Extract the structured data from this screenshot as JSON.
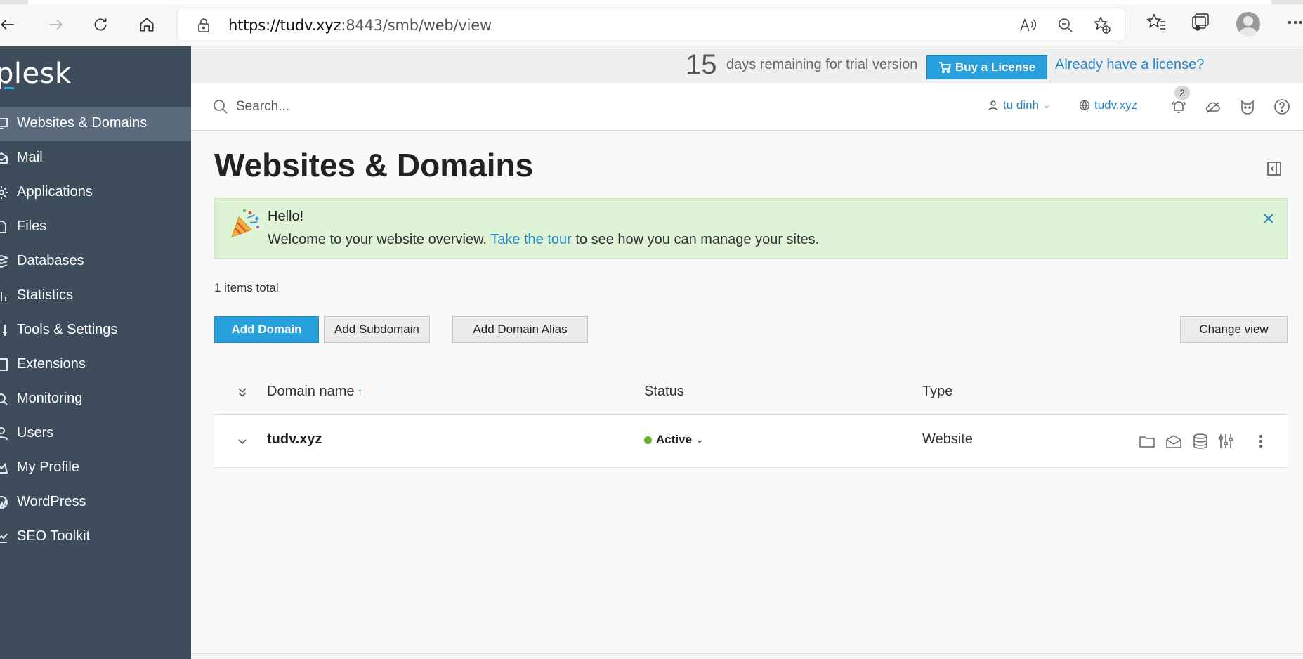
{
  "browser": {
    "url_host": "https://tudv.xyz",
    "url_rest": ":8443/smb/web/view"
  },
  "sidebar": {
    "logo": "plesk",
    "items": [
      {
        "label": "Websites & Domains",
        "icon": "monitor-icon"
      },
      {
        "label": "Mail",
        "icon": "mail-icon"
      },
      {
        "label": "Applications",
        "icon": "gear-icon"
      },
      {
        "label": "Files",
        "icon": "file-icon"
      },
      {
        "label": "Databases",
        "icon": "database-icon"
      },
      {
        "label": "Statistics",
        "icon": "bar-chart-icon"
      },
      {
        "label": "Tools & Settings",
        "icon": "sliders-icon"
      },
      {
        "label": "Extensions",
        "icon": "extensions-icon"
      },
      {
        "label": "Monitoring",
        "icon": "monitoring-icon"
      },
      {
        "label": "Users",
        "icon": "user-icon"
      },
      {
        "label": "My Profile",
        "icon": "profile-icon"
      },
      {
        "label": "WordPress",
        "icon": "wordpress-icon"
      },
      {
        "label": "SEO Toolkit",
        "icon": "seo-icon"
      }
    ]
  },
  "trial": {
    "days": "15",
    "text": "days remaining for trial version",
    "buy_label": "Buy a License",
    "license_link": "Already have a license?"
  },
  "header": {
    "search_placeholder": "Search...",
    "user_name": "tu dinh",
    "site_name": "tudv.xyz",
    "notification_count": "2"
  },
  "main": {
    "title": "Websites & Domains",
    "banner": {
      "title": "Hello!",
      "text_before": "Welcome to your website overview. ",
      "link": "Take the tour",
      "text_after": " to see how you can manage your sites."
    },
    "items_total": "1 items total",
    "buttons": {
      "add_domain": "Add Domain",
      "add_subdomain": "Add Subdomain",
      "add_alias": "Add Domain Alias",
      "change_view": "Change view"
    },
    "table": {
      "columns": [
        "Domain name",
        "Status",
        "Type"
      ],
      "sort_indicator": "↑",
      "rows": [
        {
          "domain": "tudv.xyz",
          "status": "Active",
          "type": "Website"
        }
      ]
    }
  },
  "colors": {
    "sidebar_bg": "#3d4d5c",
    "accent": "#27a0dd",
    "link": "#2885c6",
    "banner_bg": "#dff4d6",
    "status_active": "#6bb132"
  }
}
